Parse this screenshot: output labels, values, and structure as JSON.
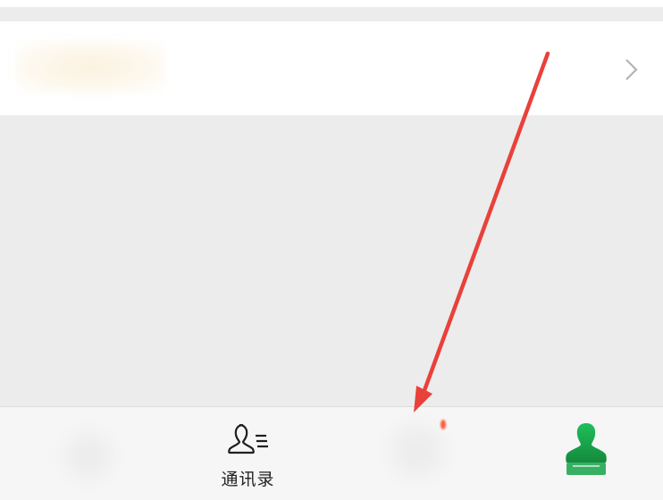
{
  "tabs": [
    {
      "label": "",
      "icon": "chat-icon"
    },
    {
      "label": "通讯录",
      "icon": "contacts-icon"
    },
    {
      "label": "",
      "icon": "discover-icon"
    },
    {
      "label": "",
      "icon": "me-icon"
    }
  ],
  "colors": {
    "annotation_arrow": "#e8413a",
    "active_tab": "#1aad4f",
    "badge": "#ff5a3c"
  }
}
